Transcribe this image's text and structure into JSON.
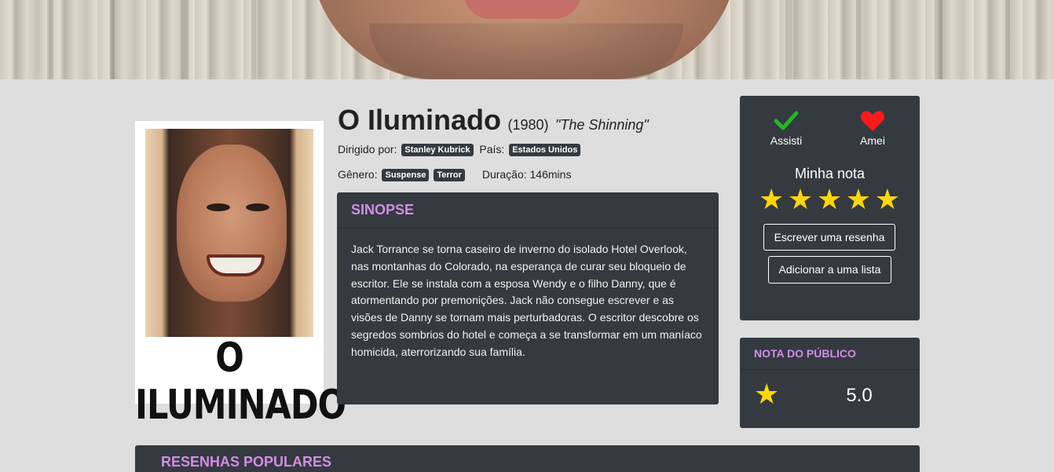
{
  "movie": {
    "title": "O Iluminado",
    "year": "(1980)",
    "original_title": "\"The Shinning\"",
    "poster_title": "O ILUMINADO",
    "directed_label": "Dirigido por:",
    "director": "Stanley Kubrick",
    "country_label": "País:",
    "country": "Estados Unidos",
    "genre_label": "Gênero:",
    "genres": [
      "Suspense",
      "Terror"
    ],
    "duration": "Duração: 146mins"
  },
  "synopsis": {
    "heading": "SINOPSE",
    "text": "Jack Torrance se torna caseiro de inverno do isolado Hotel Overlook, nas montanhas do Colorado, na esperança de curar seu bloqueio de escritor. Ele se instala com a esposa Wendy e o filho Danny, que é atormentando por premonições. Jack não consegue escrever e as visões de Danny se tornam mais perturbadoras. O escritor descobre os segredos sombrios do hotel e começa a se transformar em um maníaco homicida, aterrorizando sua família."
  },
  "actions": {
    "watched_label": "Assisti",
    "loved_label": "Amei",
    "my_rating_label": "Minha nota",
    "my_rating": 5,
    "write_review_label": "Escrever uma resenha",
    "add_to_list_label": "Adicionar a uma lista"
  },
  "public_rating": {
    "heading": "NOTA DO PÚBLICO",
    "score": "5.0"
  },
  "reviews": {
    "heading": "RESENHAS POPULARES"
  },
  "colors": {
    "card_bg": "#343a40",
    "accent": "#d48ce6",
    "star": "#ffd60a",
    "check": "#22bb22",
    "heart": "#ff1a1a"
  }
}
